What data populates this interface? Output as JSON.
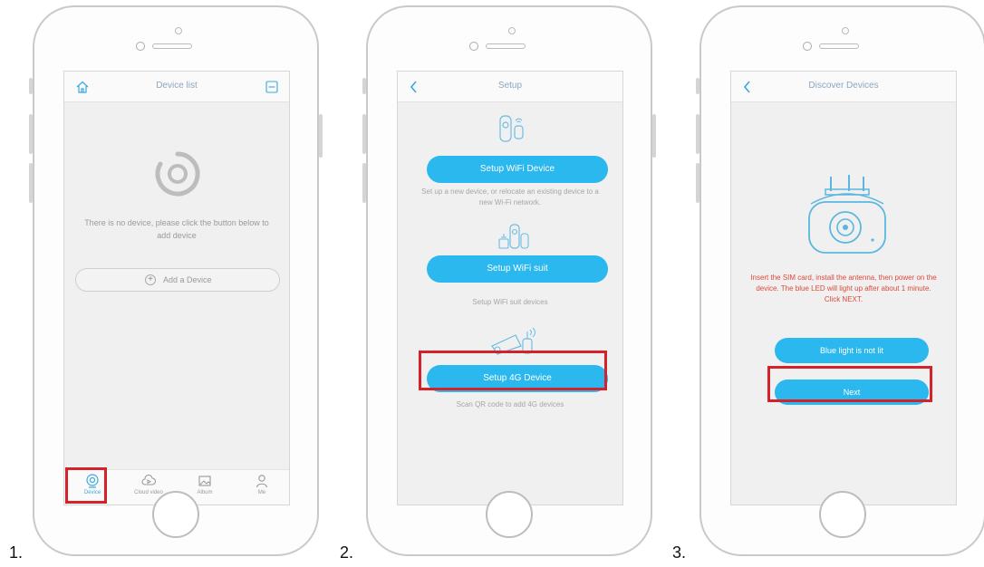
{
  "steps": [
    "1.",
    "2.",
    "3."
  ],
  "screen1": {
    "title": "Device list",
    "empty_message": "There is no device, please click the button below to add device",
    "add_button": "Add a Device",
    "tabs": [
      {
        "label": "Device",
        "icon": "camera-icon",
        "active": true
      },
      {
        "label": "Cloud video",
        "icon": "cloud-video-icon",
        "active": false
      },
      {
        "label": "Album",
        "icon": "album-icon",
        "active": false
      },
      {
        "label": "Me",
        "icon": "person-icon",
        "active": false
      }
    ]
  },
  "screen2": {
    "title": "Setup",
    "options": [
      {
        "button": "Setup WiFi Device",
        "description": "Set up a new device, or relocate an existing device to a new Wi-Fi network."
      },
      {
        "button": "Setup WiFi suit",
        "description": "Setup WiFi suit devices"
      },
      {
        "button": "Setup 4G Device",
        "description": "Scan QR code to add 4G devices"
      }
    ]
  },
  "screen3": {
    "title": "Discover Devices",
    "instructions": "Insert the SIM card, install the antenna, then power on the device. The blue LED will light up after about 1 minute. Click NEXT.",
    "secondary_button": "Blue light is not lit",
    "next_button": "Next"
  },
  "colors": {
    "accent": "#2ab8ee",
    "highlight": "#d3222a",
    "instruction_text": "#e0473a"
  }
}
